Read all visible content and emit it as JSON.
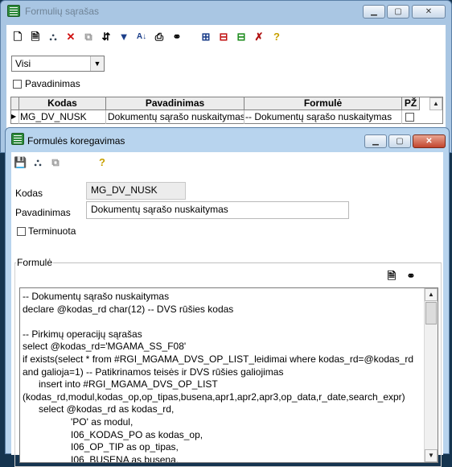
{
  "bg": {
    "title": "Formulių sąrašas",
    "toolbar_icons": [
      "new-document-icon",
      "document-icon",
      "tree-icon",
      "delete-icon",
      "copy-icon",
      "sort-tree-icon",
      "filter-icon",
      "sort-az-icon",
      "print-icon",
      "find-icon",
      "hierarchy-icon",
      "toolbox-red-icon",
      "toolbox-green-icon",
      "tools-icon",
      "help-icon"
    ],
    "filter": {
      "selected": "Visi"
    },
    "checkbox_label": "Pavadinimas",
    "grid": {
      "columns": [
        "Kodas",
        "Pavadinimas",
        "Formulė",
        "PŽ"
      ],
      "rows": [
        {
          "kodas": "MG_DV_NUSK",
          "pavadinimas": "Dokumentų sąrašo nuskaitymas",
          "formule": "-- Dokumentų sąrašo nuskaitymas"
        }
      ]
    }
  },
  "fg": {
    "title": "Formulės koregavimas",
    "toolbar_icons": [
      "save-icon",
      "tree-icon",
      "copy-icon",
      "help-icon"
    ],
    "kodas_label": "Kodas",
    "kodas_value": "MG_DV_NUSK",
    "pavadinimas_label": "Pavadinimas",
    "pavadinimas_value": "Dokumentų sąrašo nuskaitymas",
    "terminuota_label": "Terminuota",
    "formule_label": "Formulė",
    "code": "-- Dokumentų sąrašo nuskaitymas\ndeclare @kodas_rd char(12) -- DVS rūšies kodas\n\n-- Pirkimų operacijų sąrašas\nselect @kodas_rd='MGAMA_SS_F08'\nif exists(select * from #RGI_MGAMA_DVS_OP_LIST_leidimai where kodas_rd=@kodas_rd\nand galioja=1) -- Patikrinamos teisės ir DVS rūšies galiojimas\n      insert into #RGI_MGAMA_DVS_OP_LIST\n(kodas_rd,modul,kodas_op,op_tipas,busena,apr1,apr2,apr3,op_data,r_date,search_expr)\n      select @kodas_rd as kodas_rd,\n                  'PO' as modul,\n                  I06_KODAS_PO as kodas_op,\n                  I06_OP_TIP as op_tipas,\n                  I06_BUSENA as busena,"
  }
}
